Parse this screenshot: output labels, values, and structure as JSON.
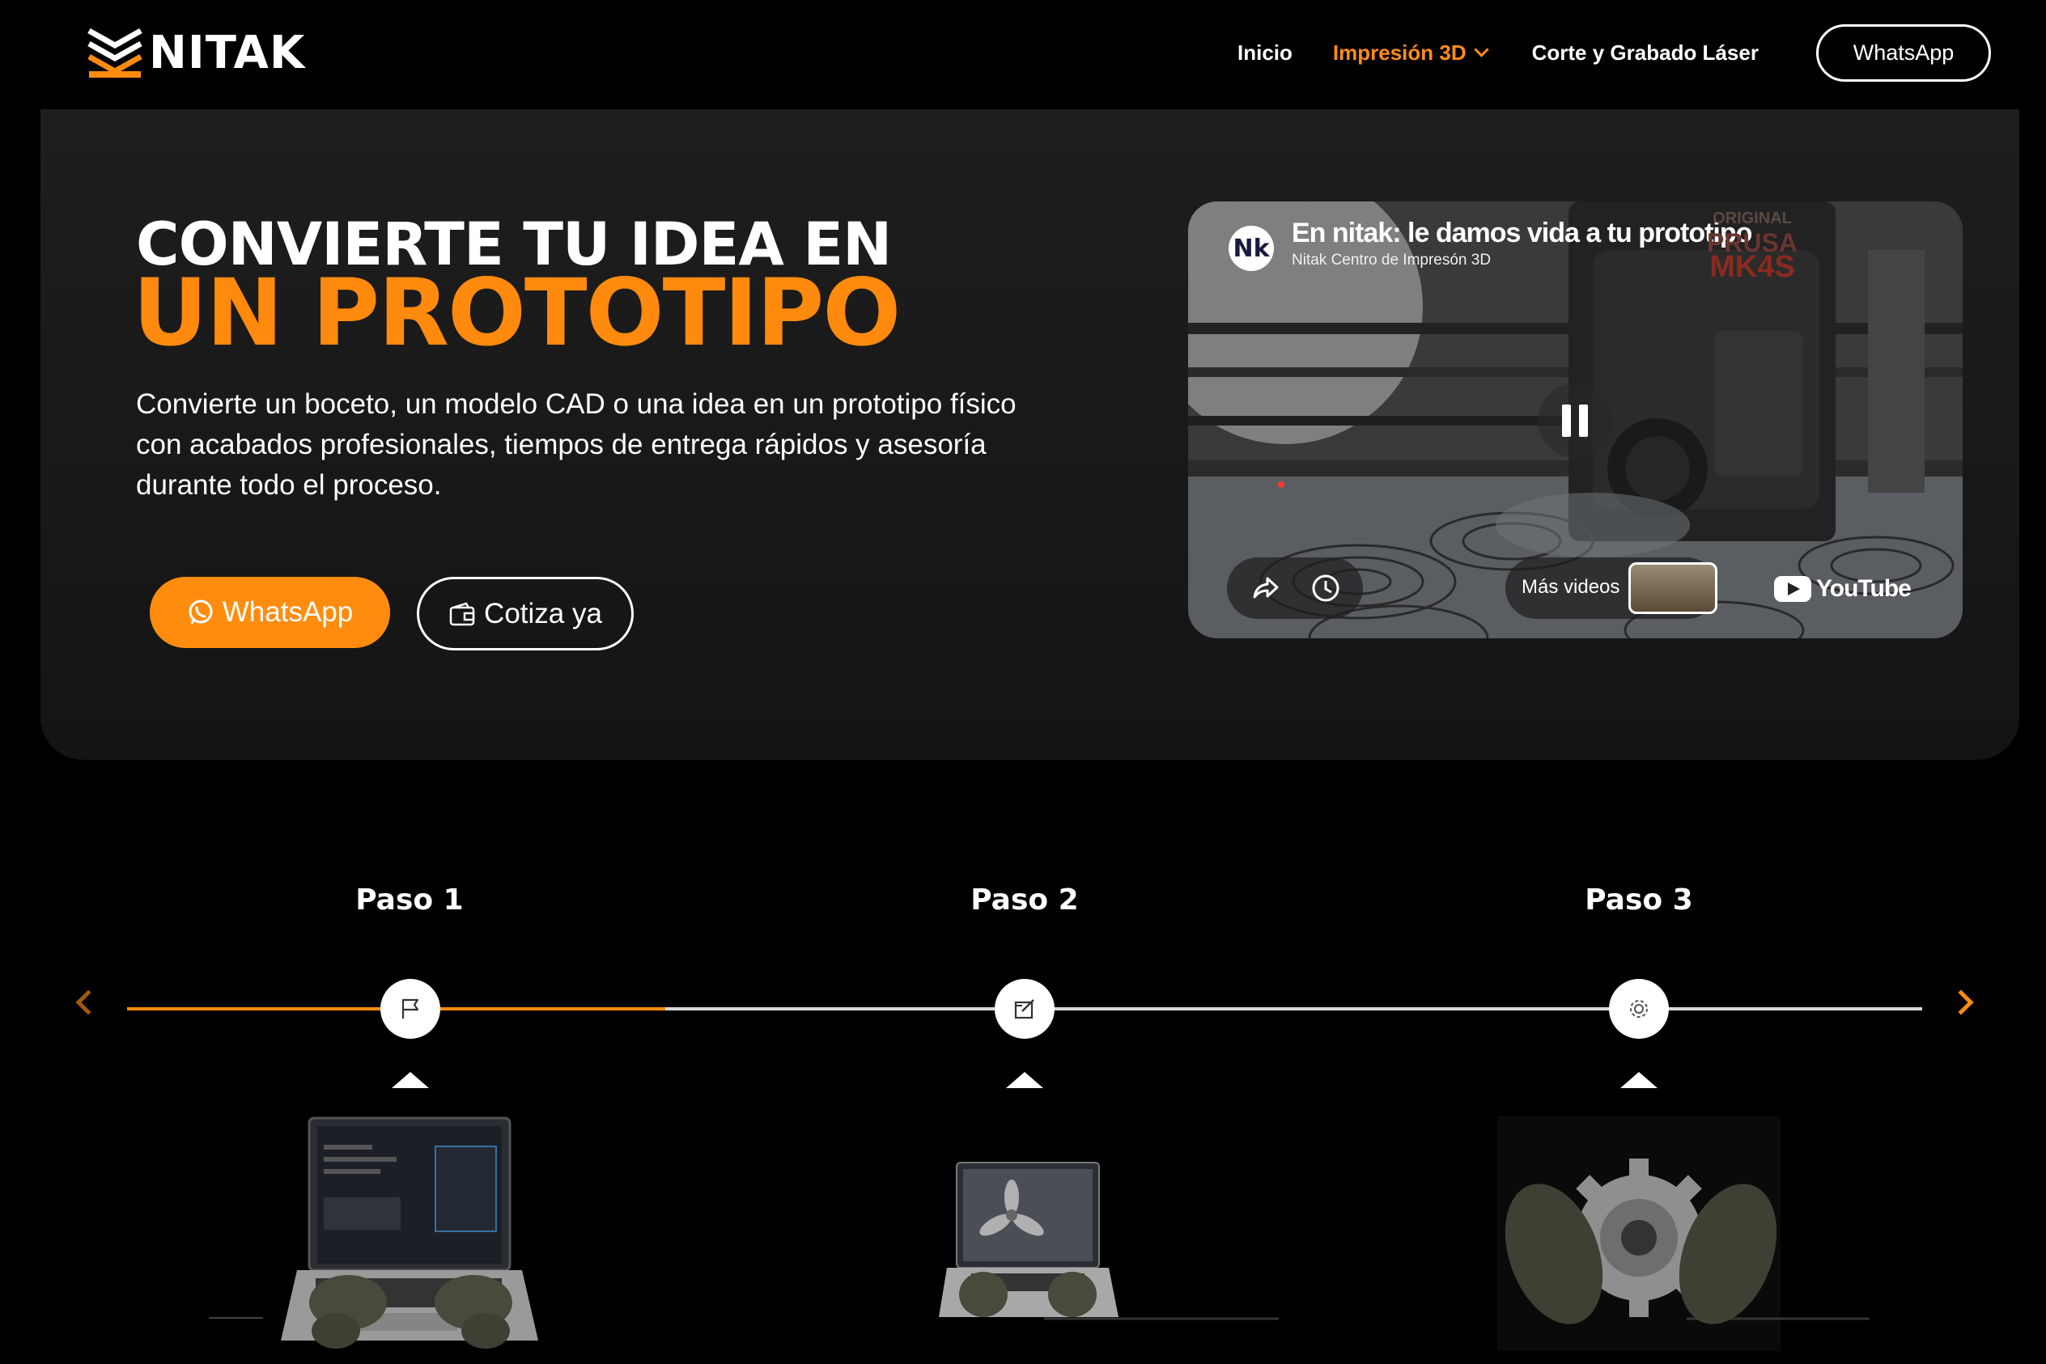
{
  "nav": {
    "brand": "NITAK",
    "links": [
      {
        "label": "Inicio",
        "active": false
      },
      {
        "label": "Impresión 3D",
        "active": true,
        "dropdown": true
      },
      {
        "label": "Corte y Grabado Láser",
        "active": false
      }
    ],
    "cta": "WhatsApp"
  },
  "hero": {
    "title_line1": "CONVIERTE TU IDEA EN",
    "title_line2": "UN PROTOTIPO",
    "description": "Convierte un boceto, un modelo CAD o una idea en un prototipo físico con acabados profesionales, tiempos de entrega rápidos y asesoría durante todo el proceso.",
    "primary_button": "WhatsApp",
    "secondary_button": "Cotiza ya"
  },
  "video": {
    "avatar_text": "Nk",
    "title": "En nitak: le damos vida a tu prototipo",
    "channel": "Nitak Centro de Impresón 3D",
    "more_videos": "Más videos",
    "youtube": "YouTube",
    "overlay_text": [
      "ORIGINAL",
      "PRUSA",
      "MK4S"
    ]
  },
  "steps": [
    {
      "label": "Paso 1",
      "icon": "flag-icon"
    },
    {
      "label": "Paso 2",
      "icon": "edit-icon"
    },
    {
      "label": "Paso 3",
      "icon": "gear-icon"
    }
  ],
  "timeline": {
    "progress_percent": 30
  },
  "colors": {
    "accent": "#ff8c0f",
    "background": "#000000",
    "hero_bg": "#1a1a1a"
  }
}
